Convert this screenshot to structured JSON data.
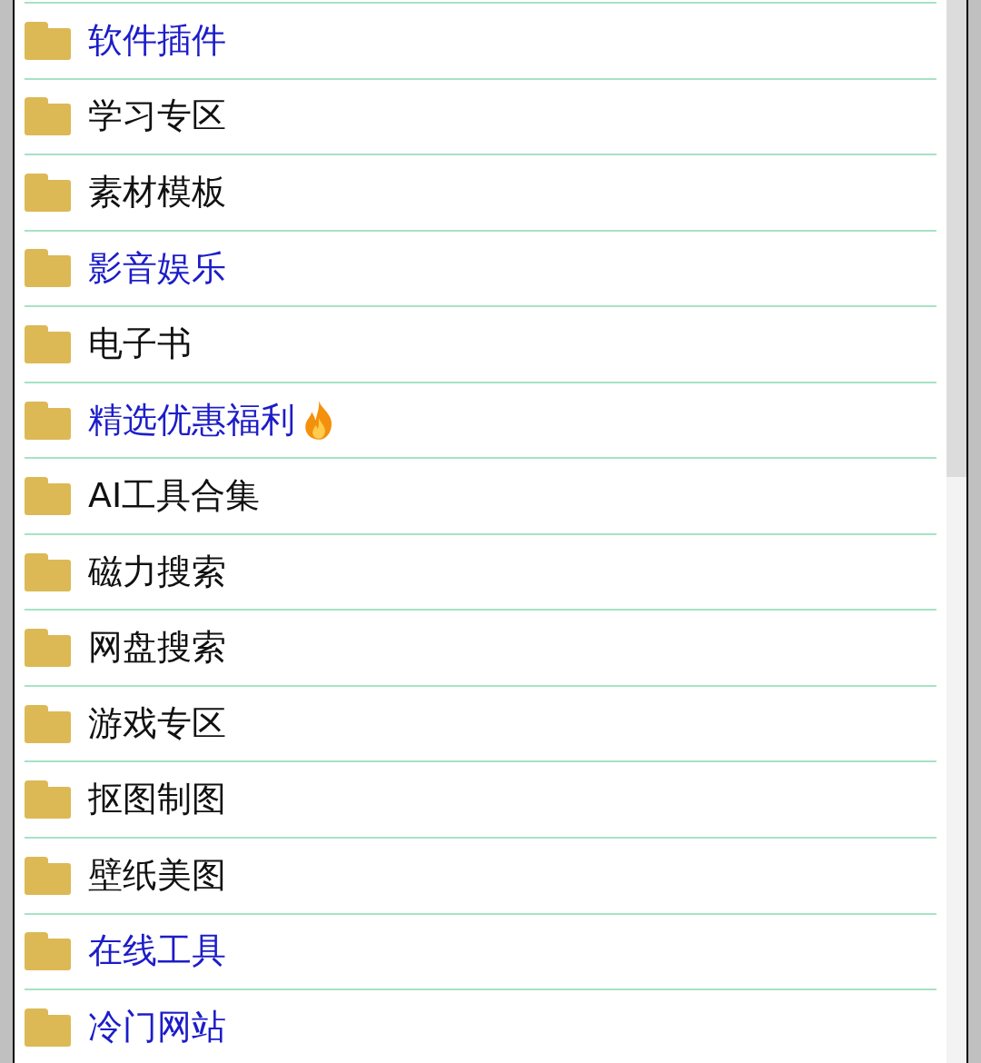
{
  "items": [
    {
      "label": "软件插件",
      "highlighted": true,
      "hot": false
    },
    {
      "label": "学习专区",
      "highlighted": false,
      "hot": false
    },
    {
      "label": "素材模板",
      "highlighted": false,
      "hot": false
    },
    {
      "label": "影音娱乐",
      "highlighted": true,
      "hot": false
    },
    {
      "label": "电子书",
      "highlighted": false,
      "hot": false
    },
    {
      "label": "精选优惠福利",
      "highlighted": true,
      "hot": true
    },
    {
      "label": "AI工具合集",
      "highlighted": false,
      "hot": false
    },
    {
      "label": "磁力搜索",
      "highlighted": false,
      "hot": false
    },
    {
      "label": "网盘搜索",
      "highlighted": false,
      "hot": false
    },
    {
      "label": "游戏专区",
      "highlighted": false,
      "hot": false
    },
    {
      "label": "抠图制图",
      "highlighted": false,
      "hot": false
    },
    {
      "label": "壁纸美图",
      "highlighted": false,
      "hot": false
    },
    {
      "label": "在线工具",
      "highlighted": true,
      "hot": false
    },
    {
      "label": "冷门网站",
      "highlighted": true,
      "hot": false
    }
  ]
}
